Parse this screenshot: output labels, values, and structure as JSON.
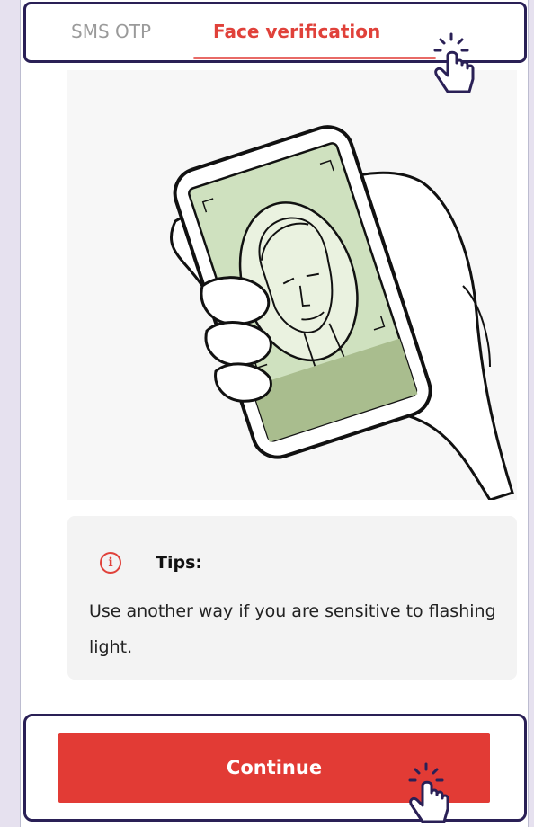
{
  "tabs": {
    "sms_label": "SMS OTP",
    "face_label": "Face verification",
    "active": "face_label"
  },
  "illustration": {
    "subject": "hand-holding-phone-face-scan"
  },
  "tips": {
    "title": "Tips:",
    "body": "Use another way if you are sensitive to flashing light.",
    "icon": "info-icon"
  },
  "cta": {
    "label": "Continue"
  },
  "colors": {
    "accent": "#e23b35",
    "highlight_frame": "#2a2056",
    "background": "#e6e1ef"
  }
}
